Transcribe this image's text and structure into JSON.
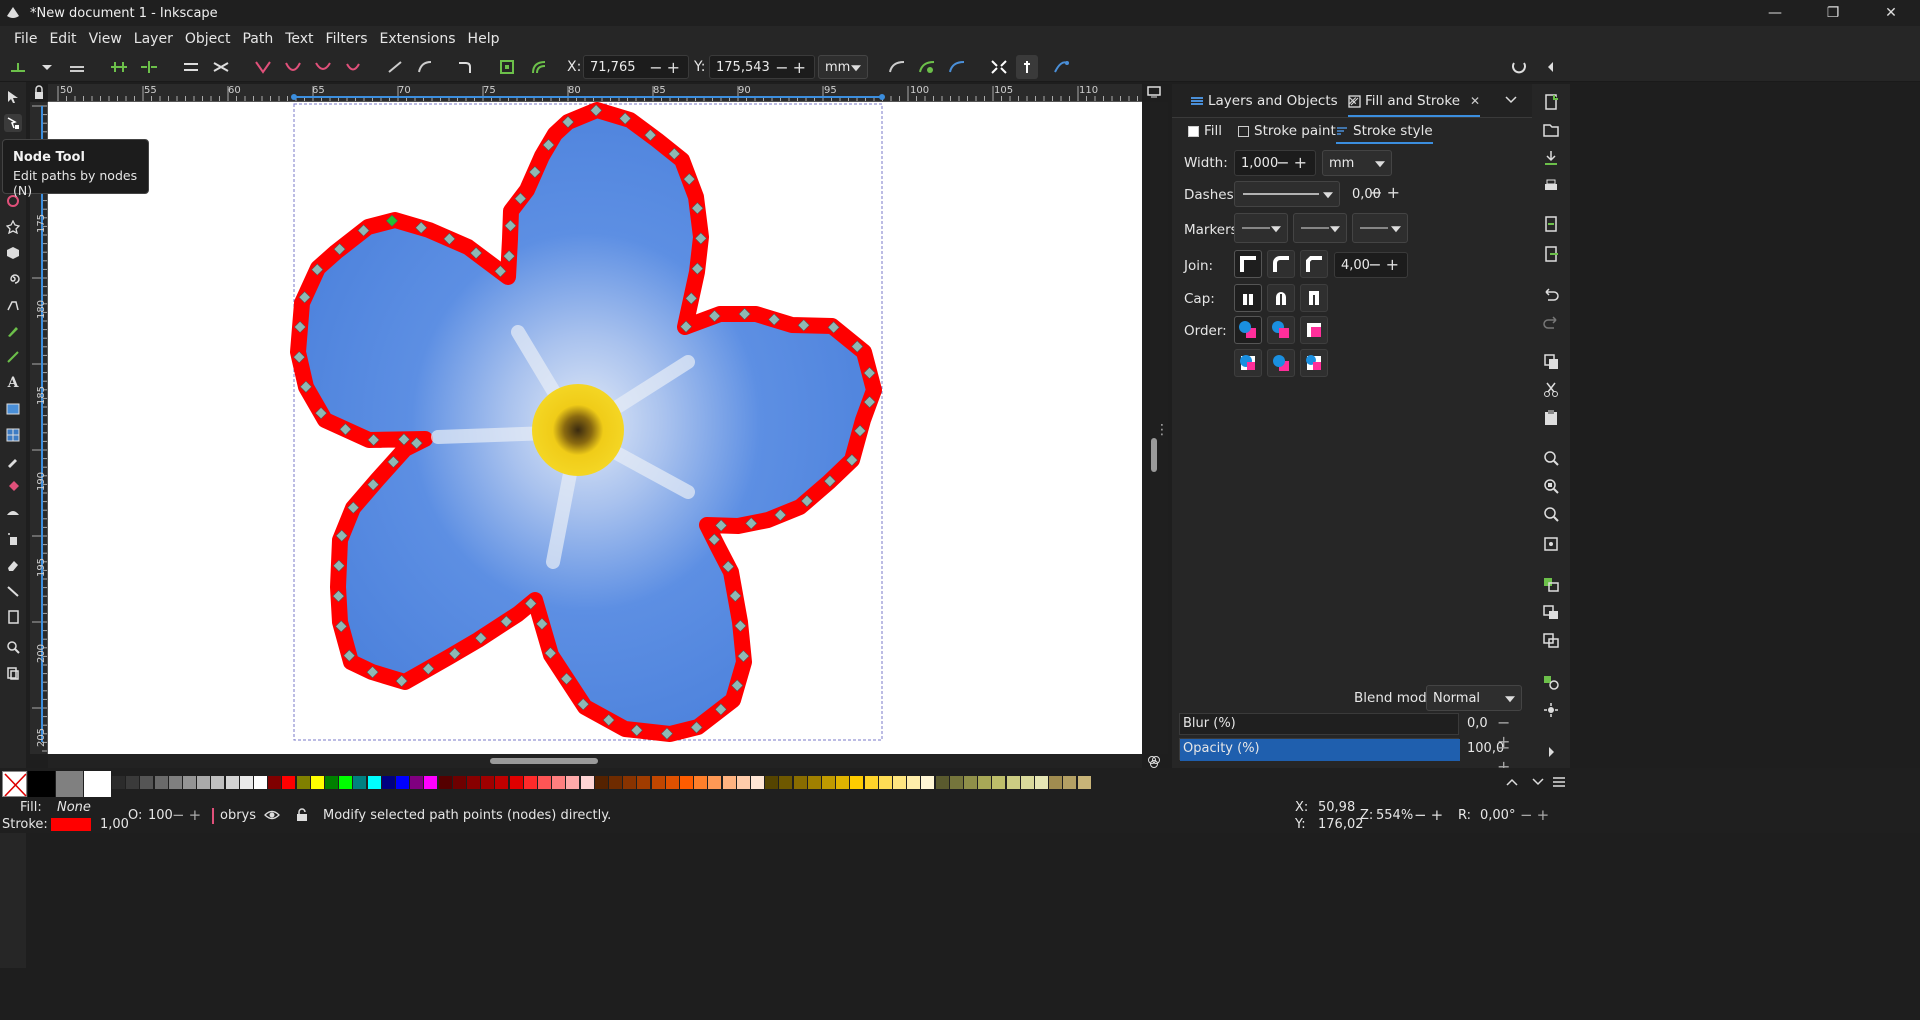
{
  "window": {
    "title": "*New document 1 - Inkscape"
  },
  "menu": [
    "File",
    "Edit",
    "View",
    "Layer",
    "Object",
    "Path",
    "Text",
    "Filters",
    "Extensions",
    "Help"
  ],
  "tool_controls": {
    "x_label": "X:",
    "x_value": "71,765",
    "y_label": "Y:",
    "y_value": "175,543",
    "unit": "mm"
  },
  "rulers": {
    "h": [
      "50",
      "55",
      "60",
      "65",
      "70",
      "75",
      "80",
      "85",
      "90",
      "95",
      "100",
      "105",
      "110"
    ],
    "v": [
      "175",
      "180",
      "185",
      "190",
      "195",
      "200",
      "205"
    ]
  },
  "tooltip": {
    "title": "Node Tool",
    "desc": "Edit paths by nodes (N)"
  },
  "dock": {
    "tabs": [
      {
        "label": "Layers and Objects"
      },
      {
        "label": "Fill and Stroke"
      }
    ],
    "subtabs": [
      "Fill",
      "Stroke paint",
      "Stroke style"
    ],
    "width_label": "Width:",
    "width_value": "1,000",
    "width_unit": "mm",
    "dashes_label": "Dashes:",
    "dashes_value": "0,00",
    "markers_label": "Markers:",
    "join_label": "Join:",
    "join_value": "4,00",
    "cap_label": "Cap:",
    "order_label": "Order:",
    "blend_label": "Blend mode:",
    "blend_value": "Normal",
    "blur_label": "Blur (%)",
    "blur_value": "0,0",
    "opacity_label": "Opacity (%)",
    "opacity_value": "100,0",
    "opacity_fraction": 1.0
  },
  "status": {
    "fill_label": "Fill:",
    "fill_value": "None",
    "stroke_label": "Stroke:",
    "stroke_width": "1,00",
    "opacity_label": "O:",
    "opacity_value": "100",
    "layer_name": "obrys",
    "message": "Modify selected path points (nodes) directly.",
    "cursor_x_label": "X:",
    "cursor_x": "50,98",
    "cursor_y_label": "Y:",
    "cursor_y": "176,02",
    "zoom_label": "Z:",
    "zoom": "554%",
    "rotate_label": "R:",
    "rotate": "0,00°"
  },
  "colors": {
    "accent": "#1f5fae",
    "stroke_red": "#ff0000",
    "petal_blue": "#5b8fe6",
    "center_yellow": "#f2d21a"
  }
}
